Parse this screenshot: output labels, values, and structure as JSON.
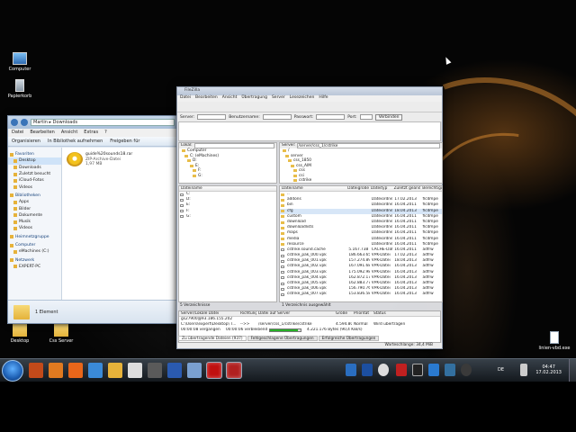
{
  "desktop": {
    "icons": [
      {
        "label": "Computer",
        "icon": "computer-icon"
      },
      {
        "label": "Papierkorb",
        "icon": "recycle-bin-icon"
      },
      {
        "label": "Desktop",
        "icon": "folder-icon"
      },
      {
        "label": "Css Server",
        "icon": "folder-icon"
      },
      {
        "label": "linien-vbd.exe",
        "icon": "exe-file-icon"
      }
    ]
  },
  "explorer": {
    "address": [
      "Martin",
      "Downloads"
    ],
    "menu": [
      "Datei",
      "Bearbeiten",
      "Ansicht",
      "Extras",
      "?"
    ],
    "toolbar": [
      "Organisieren",
      "In Bibliothek aufnehmen",
      "Freigeben für"
    ],
    "nav": [
      {
        "label": "Favoriten",
        "group": true
      },
      {
        "label": "Desktop",
        "selected": true
      },
      {
        "label": "Downloads"
      },
      {
        "label": "Zuletzt besucht"
      },
      {
        "label": "iCloud-Fotos"
      },
      {
        "label": "Videos"
      },
      {
        "label": "Bibliotheken",
        "group": true
      },
      {
        "label": "Apps"
      },
      {
        "label": "Bilder"
      },
      {
        "label": "Dokumente"
      },
      {
        "label": "Musik"
      },
      {
        "label": "Videos"
      },
      {
        "label": "Heimnetzgruppe",
        "group": true
      },
      {
        "label": "Computer",
        "group": true
      },
      {
        "label": "eMachines (C:)"
      },
      {
        "label": "Netzwerk",
        "group": true
      },
      {
        "label": "EXPERT-PC"
      }
    ],
    "file": {
      "name": "guide%20sounds18.rar",
      "type": "ZIP-Archive-Datei",
      "size": "1,97 MB"
    },
    "status": "1 Element"
  },
  "filezilla": {
    "title": "FileZilla",
    "menu": [
      "Datei",
      "Bearbeiten",
      "Ansicht",
      "Übertragung",
      "Server",
      "Lesezeichen",
      "Hilfe"
    ],
    "quickconnect": {
      "server_label": "Server:",
      "user_label": "Benutzername:",
      "pass_label": "Passwort:",
      "port_label": "Port:",
      "button": "Verbinden"
    },
    "local": {
      "label": "Lokal:",
      "tree": [
        "Computer",
        "C: (eMachines)",
        "D:",
        "E:",
        "F:",
        "G:"
      ],
      "columns": [
        "Dateiname"
      ],
      "files": [
        "C:",
        "D:",
        "E:",
        "F:",
        "G:"
      ],
      "status": "5 Verzeichnisse"
    },
    "remote": {
      "label": "Server:",
      "path": "/server/css_1/cstrike",
      "tree": [
        "/",
        "server",
        "css_1850",
        "css_AIM",
        "css",
        "csi",
        "cstrike"
      ],
      "columns": [
        "Dateiname",
        "Dateigröße",
        "Dateityp",
        "Zuletzt geändert",
        "Berechtigungen"
      ],
      "files": [
        {
          "name": "..",
          "size": "",
          "type": "",
          "date": "",
          "perm": ""
        },
        {
          "name": "addons",
          "size": "",
          "type": "Dateiordner",
          "date": "17.02.2013",
          "perm": "flcdmpe"
        },
        {
          "name": "bin",
          "size": "",
          "type": "Dateiordner",
          "date": "16.04.2011",
          "perm": "flcdmpe"
        },
        {
          "name": "cfg",
          "size": "",
          "type": "Dateiordner",
          "date": "18.04.2013",
          "perm": "flcdmpe",
          "selected": true
        },
        {
          "name": "custom",
          "size": "",
          "type": "Dateiordner",
          "date": "16.04.2011",
          "perm": "flcdmpe"
        },
        {
          "name": "download",
          "size": "",
          "type": "Dateiordner",
          "date": "16.04.2011",
          "perm": "flcdmpe"
        },
        {
          "name": "downloadlists",
          "size": "",
          "type": "Dateiordner",
          "date": "16.04.2011",
          "perm": "flcdmpe"
        },
        {
          "name": "maps",
          "size": "",
          "type": "Dateiordner",
          "date": "16.04.2011",
          "perm": "flcdmpe"
        },
        {
          "name": "media",
          "size": "",
          "type": "Dateiordner",
          "date": "16.04.2011",
          "perm": "flcdmpe"
        },
        {
          "name": "resource",
          "size": "",
          "type": "Dateiordner",
          "date": "16.04.2011",
          "perm": "flcdmpe"
        },
        {
          "name": "cstrike.sound.cache",
          "size": "5.167.738",
          "type": "CACHE-Datei",
          "date": "16.04.2011",
          "perm": "adfrw"
        },
        {
          "name": "cstrike_pak_000.vpk",
          "size": "186.663.657",
          "type": "VPK-Datei",
          "date": "17.02.2013",
          "perm": "adfrw"
        },
        {
          "name": "cstrike_pak_001.vpk",
          "size": "157.274.899",
          "type": "VPK-Datei",
          "date": "18.04.2013",
          "perm": "adfrw"
        },
        {
          "name": "cstrike_pak_002.vpk",
          "size": "167.091.685",
          "type": "VPK-Datei",
          "date": "16.04.2013",
          "perm": "adfrw"
        },
        {
          "name": "cstrike_pak_003.vpk",
          "size": "175.092.983",
          "type": "VPK-Datei",
          "date": "16.04.2013",
          "perm": "adfrw"
        },
        {
          "name": "cstrike_pak_004.vpk",
          "size": "162.872.174",
          "type": "VPK-Datei",
          "date": "16.04.2013",
          "perm": "adfrw"
        },
        {
          "name": "cstrike_pak_005.vpk",
          "size": "162.883.775",
          "type": "VPK-Datei",
          "date": "16.04.2013",
          "perm": "adfrw"
        },
        {
          "name": "cstrike_pak_006.vpk",
          "size": "156.790.766",
          "type": "VPK-Datei",
          "date": "16.04.2013",
          "perm": "adfrw"
        },
        {
          "name": "cstrike_pak_007.vpk",
          "size": "153.836.581",
          "type": "VPK-Datei",
          "date": "16.04.2013",
          "perm": "adfrw"
        }
      ],
      "status": "1 Verzeichnis ausgewählt"
    },
    "queue": {
      "columns": [
        "Server/Lokale Datei",
        "Richtung",
        "Datei auf Server",
        "Größe",
        "Priorität",
        "Status"
      ],
      "rows": [
        {
          "server": "gs27900@93.186.155.202",
          "direction": "",
          "remote": "",
          "size": "",
          "priority": "",
          "status": ""
        },
        {
          "server": "C:\\Users\\expert\\Desktop\\ T...",
          "direction": "-->>",
          "remote": "/server/css_1/cstrike/cstrike",
          "size": "4.594.806",
          "priority": "Normal",
          "status": "Wird übertragen"
        },
        {
          "server": "00:00:08 vergangen",
          "direction": "",
          "remote": "00:00:06 verbleibend",
          "size": "4.221.176 Bytes (90,4 KiB/s)",
          "priority": "",
          "status": "",
          "progress": 0.92
        }
      ],
      "tabs": [
        "Zu übertragende Dateien (937)",
        "Fehlgeschlagene Übertragungen",
        "Erfolgreiche Übertragungen"
      ],
      "footer": "Warteschlange: 34,4 MiB"
    }
  },
  "taskbar": {
    "apps": [
      {
        "icon": "game-icon"
      },
      {
        "icon": "media-player-icon"
      },
      {
        "icon": "firefox-icon"
      },
      {
        "icon": "ie-icon"
      },
      {
        "icon": "explorer-icon"
      },
      {
        "icon": "paint-icon"
      },
      {
        "icon": "video-icon"
      },
      {
        "icon": "word-icon"
      },
      {
        "icon": "picture-icon"
      },
      {
        "icon": "filezilla-icon"
      },
      {
        "icon": "recorder-icon"
      }
    ],
    "lang": "DE",
    "time": "04:47",
    "date": "17.02.2013"
  }
}
